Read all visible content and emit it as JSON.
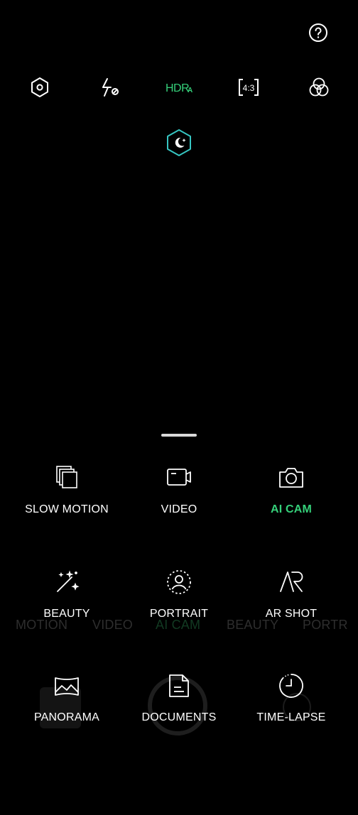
{
  "colors": {
    "background": "#000000",
    "accent": "#35d07a",
    "night_teal": "#36c6c2",
    "text": "#ffffff",
    "ghost_text": "#2e2e2e"
  },
  "top_bar": {
    "help_icon": "question-circle-icon",
    "controls": [
      {
        "name": "settings",
        "icon": "hexagon-settings-icon"
      },
      {
        "name": "flash",
        "icon": "flash-off-icon"
      },
      {
        "name": "hdr",
        "icon": "hdr-auto-icon",
        "text": "HDR",
        "sub": "A"
      },
      {
        "name": "aspect-ratio",
        "icon": "aspect-ratio-icon",
        "text": "4:3"
      },
      {
        "name": "filter",
        "icon": "filter-circles-icon"
      }
    ],
    "night_mode_icon": "night-mode-icon"
  },
  "modes": [
    {
      "label": "SLOW MOTION",
      "icon": "slow-motion-icon",
      "active": false
    },
    {
      "label": "VIDEO",
      "icon": "video-camera-icon",
      "active": false
    },
    {
      "label": "AI CAM",
      "icon": "camera-icon",
      "active": true
    },
    {
      "label": "BEAUTY",
      "icon": "magic-wand-icon",
      "active": false
    },
    {
      "label": "PORTRAIT",
      "icon": "portrait-icon",
      "active": false
    },
    {
      "label": "AR SHOT",
      "icon": "ar-icon",
      "active": false
    },
    {
      "label": "PANORAMA",
      "icon": "panorama-icon",
      "active": false
    },
    {
      "label": "DOCUMENTS",
      "icon": "document-icon",
      "active": false
    },
    {
      "label": "TIME-LAPSE",
      "icon": "timer-icon",
      "active": false
    }
  ],
  "background_mode_strip": [
    "MOTION",
    "VIDEO",
    "AI CAM",
    "BEAUTY",
    "PORTR"
  ]
}
